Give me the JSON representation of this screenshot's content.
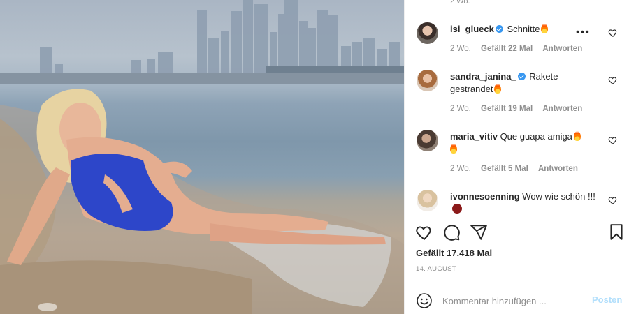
{
  "post": {
    "likes_text": "Gefällt 17.418 Mal",
    "date": "14. AUGUST",
    "top_meta": "2 Wo."
  },
  "comments": [
    {
      "username": "isi_glueck",
      "verified": true,
      "text": "Schnitte",
      "emoji": "fire",
      "age": "2 Wo.",
      "likes": "Gefällt 22 Mal",
      "reply": "Antworten"
    },
    {
      "username": "sandra_janina_",
      "verified": true,
      "text": "Rakete gestrandet",
      "emoji": "fire",
      "age": "2 Wo.",
      "likes": "Gefällt 19 Mal",
      "reply": "Antworten"
    },
    {
      "username": "maria_vitiv",
      "verified": false,
      "text": "Que guapa amiga",
      "emoji": "fire fire",
      "age": "2 Wo.",
      "likes": "Gefällt 5 Mal",
      "reply": "Antworten"
    },
    {
      "username": "ivonnesoenning",
      "verified": false,
      "text": "Wow wie schön !!!",
      "emoji": "scream",
      "age": "",
      "likes": "",
      "reply": ""
    }
  ],
  "add_comment": {
    "placeholder": "Kommentar hinzufügen ...",
    "post_label": "Posten"
  },
  "icons": {
    "like": "heart-icon",
    "comment": "comment-icon",
    "share": "share-icon",
    "save": "bookmark-icon",
    "more": "more-icon",
    "emoji": "smiley-icon"
  },
  "colors": {
    "verified": "#3897f0",
    "muted": "#8e8e8e",
    "post_button": "#b2dffc"
  }
}
